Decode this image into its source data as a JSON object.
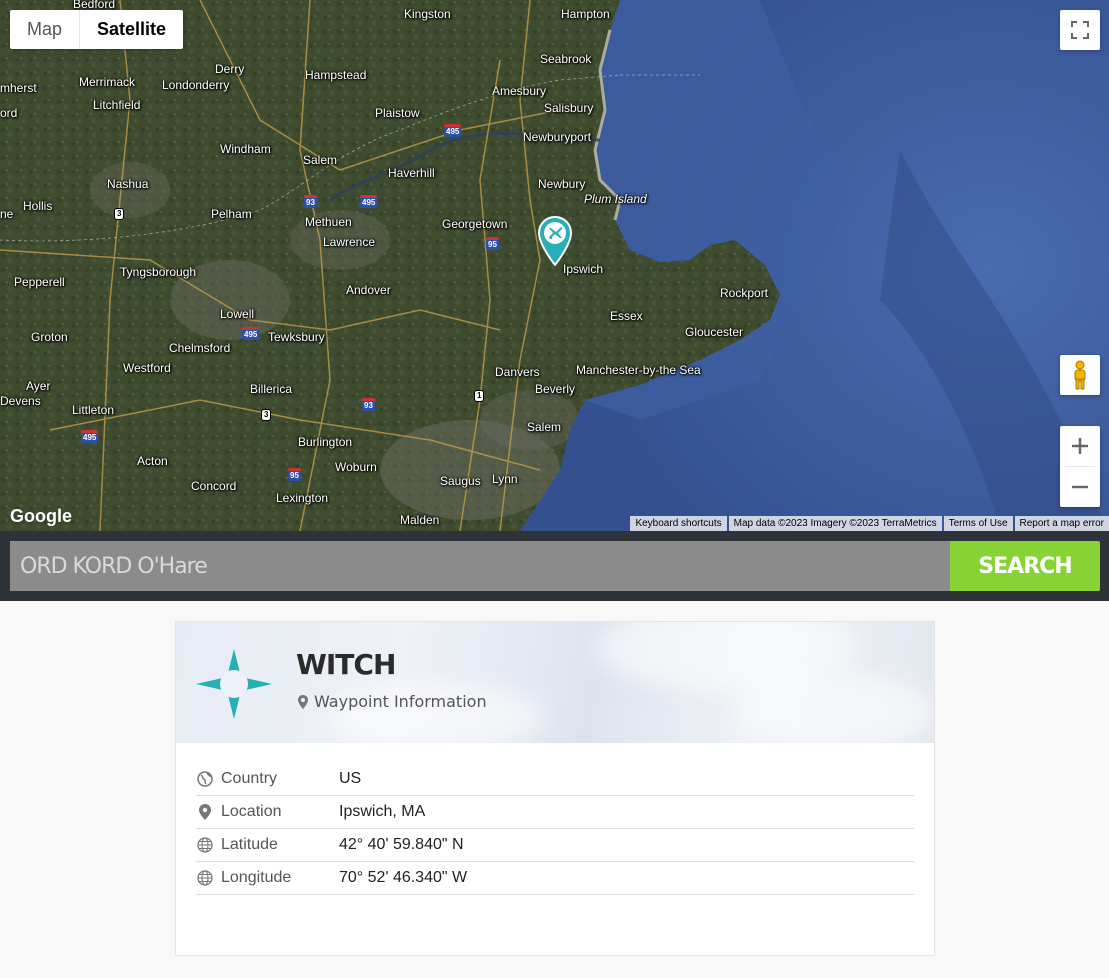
{
  "map": {
    "type_controls": {
      "map_label": "Map",
      "satellite_label": "Satellite",
      "active": "satellite"
    },
    "icons": {
      "fullscreen": "fullscreen-icon",
      "pegman": "pegman-icon",
      "zoom_in": "plus-icon",
      "zoom_out": "minus-icon",
      "marker": "airplane-marker-icon"
    },
    "colors": {
      "marker": "#26b0b5",
      "water": "#3f5f9e",
      "land": "#3d4a2c"
    },
    "places": [
      {
        "name": "Bedford"
      },
      {
        "name": "Kingston"
      },
      {
        "name": "Hampton"
      },
      {
        "name": "Seabrook"
      },
      {
        "name": "Derry"
      },
      {
        "name": "Hampstead"
      },
      {
        "name": "Amesbury"
      },
      {
        "name": "mherst"
      },
      {
        "name": "Merrimack"
      },
      {
        "name": "Londonderry"
      },
      {
        "name": "Salisbury"
      },
      {
        "name": "Litchfield"
      },
      {
        "name": "Plaistow"
      },
      {
        "name": "ord"
      },
      {
        "name": "Newburyport"
      },
      {
        "name": "Windham"
      },
      {
        "name": "Salem"
      },
      {
        "name": "Haverhill"
      },
      {
        "name": "Nashua"
      },
      {
        "name": "Newbury"
      },
      {
        "name": "Plum Island"
      },
      {
        "name": "Hollis"
      },
      {
        "name": "Pelham"
      },
      {
        "name": "ne"
      },
      {
        "name": "Methuen"
      },
      {
        "name": "Georgetown"
      },
      {
        "name": "Lawrence"
      },
      {
        "name": "Ipswich"
      },
      {
        "name": "Tyngsborough"
      },
      {
        "name": "Pepperell"
      },
      {
        "name": "Andover"
      },
      {
        "name": "Rockport"
      },
      {
        "name": "Lowell"
      },
      {
        "name": "Essex"
      },
      {
        "name": "Tewksbury"
      },
      {
        "name": "Gloucester"
      },
      {
        "name": "Groton"
      },
      {
        "name": "Chelmsford"
      },
      {
        "name": "Westford"
      },
      {
        "name": "Danvers"
      },
      {
        "name": "Manchester-by-the Sea"
      },
      {
        "name": "Ayer"
      },
      {
        "name": "Billerica"
      },
      {
        "name": "Beverly"
      },
      {
        "name": "Devens"
      },
      {
        "name": "Littleton"
      },
      {
        "name": "Salem"
      },
      {
        "name": "Burlington"
      },
      {
        "name": "Acton"
      },
      {
        "name": "Woburn"
      },
      {
        "name": "Concord"
      },
      {
        "name": "Saugus"
      },
      {
        "name": "Lynn"
      },
      {
        "name": "Lexington"
      },
      {
        "name": "Malden"
      }
    ],
    "shields": [
      {
        "text": "495"
      },
      {
        "text": "93"
      },
      {
        "text": "495"
      },
      {
        "text": "3"
      },
      {
        "text": "95"
      },
      {
        "text": "495"
      },
      {
        "text": "93"
      },
      {
        "text": "1"
      },
      {
        "text": "3"
      },
      {
        "text": "495"
      },
      {
        "text": "95"
      }
    ],
    "logo": "Google",
    "attribution": [
      "Keyboard shortcuts",
      "Map data ©2023 Imagery ©2023 TerraMetrics",
      "Terms of Use",
      "Report a map error"
    ]
  },
  "search": {
    "placeholder": "ORD KORD O'Hare",
    "value": "",
    "button_label": "SEARCH"
  },
  "waypoint": {
    "name": "WITCH",
    "subtitle": "Waypoint Information",
    "rows": [
      {
        "label": "Country",
        "value": "US",
        "icon": "globe-icon"
      },
      {
        "label": "Location",
        "value": "Ipswich, MA",
        "icon": "map-pin-icon"
      },
      {
        "label": "Latitude",
        "value": "42° 40' 59.840\" N",
        "icon": "globe-grid-icon"
      },
      {
        "label": "Longitude",
        "value": "70° 52' 46.340\" W",
        "icon": "globe-grid-icon"
      }
    ]
  }
}
